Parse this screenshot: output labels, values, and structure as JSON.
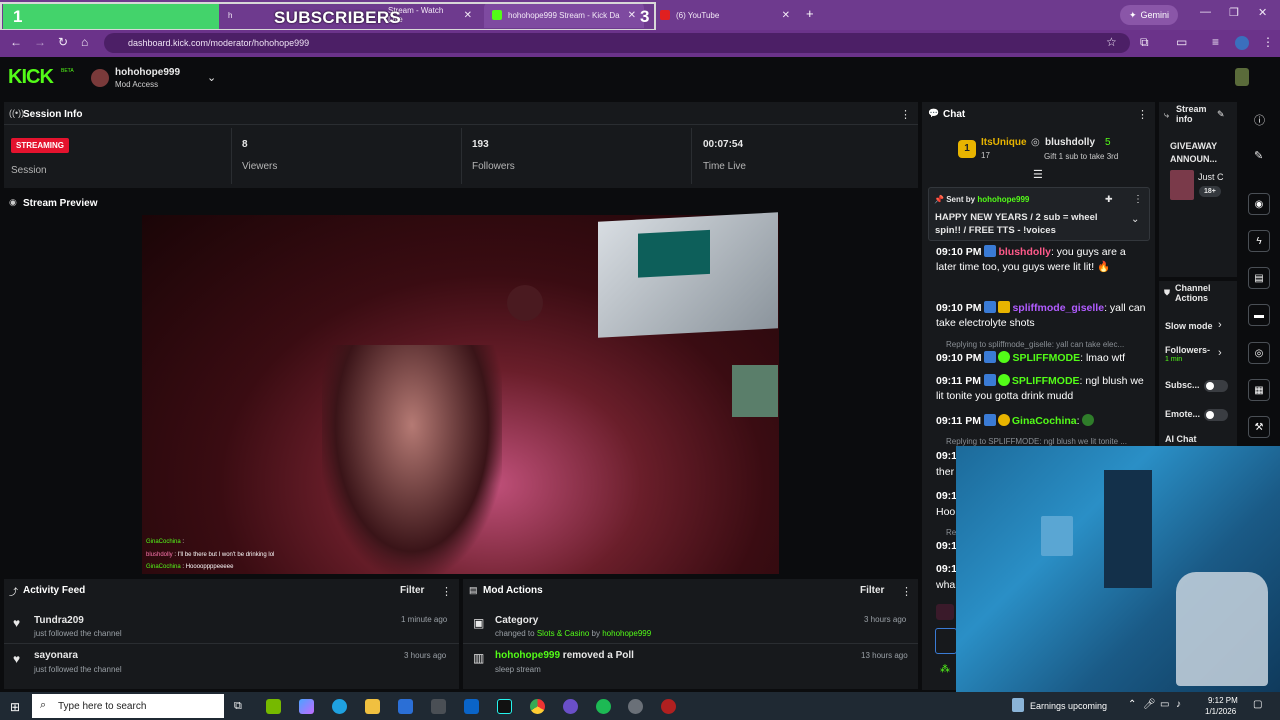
{
  "browser": {
    "tabs": [
      {
        "label": "h"
      },
      {
        "label": "Stream - Watch Live"
      },
      {
        "label": "hohohope999 Stream - Kick Da"
      },
      {
        "label": "(6) YouTube"
      }
    ],
    "gemini_label": "Gemini",
    "url": "dashboard.kick.com/moderator/hohohope999"
  },
  "overlay": {
    "left_count": "1",
    "label": "SUBSCRIBERS",
    "right_count": "3"
  },
  "header": {
    "logo": "KICK",
    "beta": "BETA",
    "username": "hohohope999",
    "role": "Mod Access"
  },
  "session": {
    "title": "Session Info",
    "status_badge": "STREAMING",
    "stats": [
      {
        "value": "",
        "label": "Session"
      },
      {
        "value": "8",
        "label": "Viewers"
      },
      {
        "value": "193",
        "label": "Followers"
      },
      {
        "value": "00:07:54",
        "label": "Time Live"
      }
    ]
  },
  "preview": {
    "title": "Stream Preview",
    "overlay_chat": [
      {
        "user": "GinaCochina",
        "text": ""
      },
      {
        "user": "blushdolly",
        "text": "I'll be there but I won't be drinking lol"
      },
      {
        "user": "GinaCochina",
        "text": "Hooooppppeeeee"
      }
    ]
  },
  "activity": {
    "title": "Activity Feed",
    "filter_label": "Filter",
    "items": [
      {
        "name": "Tundra209",
        "desc": "just followed the channel",
        "time": "1 minute ago"
      },
      {
        "name": "sayonara",
        "desc": "just followed the channel",
        "time": "3 hours ago"
      }
    ]
  },
  "mod_actions": {
    "title": "Mod Actions",
    "filter_label": "Filter",
    "items": [
      {
        "title": "Category",
        "desc_prefix": "changed to",
        "desc_link": "Slots & Casino",
        "desc_by": "by",
        "desc_user": "hohohope999",
        "time": "3 hours ago"
      },
      {
        "title_user": "hohohope999",
        "title": "removed a Poll",
        "desc": "sleep stream",
        "time": "13 hours ago"
      }
    ]
  },
  "chat": {
    "title": "Chat",
    "leaderboard": [
      {
        "rank": "1",
        "name": "ItsUnique",
        "count": "17"
      },
      {
        "name": "blushdolly",
        "count": "5",
        "sub": "Gift 1 sub to take 3rd"
      }
    ],
    "pinned": {
      "sent_by_label": "Sent by",
      "sender": "hohohope999",
      "text": "HAPPY NEW YEARS / 2 sub = wheel spin!! / FREE TTS - !voices"
    },
    "messages": [
      {
        "time": "09:10 PM",
        "user": "blushdolly",
        "user_color": "#ff5a8a",
        "text": ": you guys are a later time too, you guys were lit lit! 🔥"
      },
      {
        "time": "09:10 PM",
        "user": "spliffmode_giselle",
        "user_color": "#b15cff",
        "text": ": yall can take electrolyte shots"
      },
      {
        "reply": "Replying to spliffmode_giselle: yall can take elec...",
        "time": "09:10 PM",
        "user": "SPLIFFMODE",
        "user_color": "#53fc18",
        "text": ": lmao wtf"
      },
      {
        "time": "09:11 PM",
        "user": "SPLIFFMODE",
        "user_color": "#53fc18",
        "text": ": ngl blush we lit tonite you gotta drink mudd"
      },
      {
        "time": "09:11 PM",
        "user": "GinaCochina",
        "user_color": "#53fc18",
        "text": ":"
      },
      {
        "reply": "Replying to SPLIFFMODE: ngl blush we lit tonite ..."
      },
      {
        "time": "09:1",
        "text": "ther"
      },
      {
        "time": "09:1",
        "text": "Hoo"
      },
      {
        "reply": "Re"
      },
      {
        "time": "09:1",
        "text": ""
      },
      {
        "time": "09:1",
        "text": "wha"
      }
    ]
  },
  "stream_info": {
    "title": "Stream info",
    "announce": "GIVEAWAY ANNOUN...",
    "card_title": "Just C",
    "card_badge": "18+"
  },
  "channel_actions": {
    "title": "Channel Actions",
    "items": [
      {
        "label": "Slow mode"
      },
      {
        "label": "Followers-",
        "sub": "1 min"
      },
      {
        "label": "Subsc..."
      },
      {
        "label": "Emote..."
      },
      {
        "label": "AI Chat"
      }
    ]
  },
  "taskbar": {
    "search_placeholder": "Type here to search",
    "weather": "Earnings upcoming",
    "time": "9:12 PM",
    "date": "1/1/2026"
  },
  "colors": {
    "kick_green": "#53fc18",
    "chrome_purple": "#6e3a8e",
    "panel": "#17191c",
    "streaming_red": "#e4132e"
  }
}
